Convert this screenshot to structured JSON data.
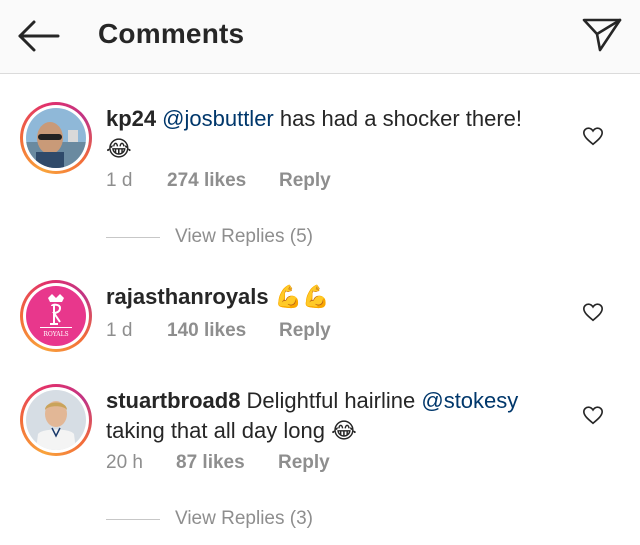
{
  "header": {
    "title": "Comments",
    "back_icon": "arrow-left-icon",
    "send_icon": "paper-plane-icon"
  },
  "comments": [
    {
      "username": "kp24",
      "mention": "@josbuttler",
      "text": " has had a shocker there!",
      "emoji": "😂",
      "time": "1 d",
      "likes": "274 likes",
      "reply": "Reply",
      "view_replies": "View Replies (5)"
    },
    {
      "username": "rajasthanroyals",
      "text": "",
      "emoji": "💪💪",
      "time": "1 d",
      "likes": "140 likes",
      "reply": "Reply",
      "logo_text": "ROYALS"
    },
    {
      "username": "stuartbroad8",
      "text_before": "Delightful hairline ",
      "mention": "@stokesy",
      "text_after": "taking that all day long",
      "emoji": "😂",
      "time": "20 h",
      "likes": "87 likes",
      "reply": "Reply",
      "view_replies": "View Replies (3)"
    }
  ],
  "colors": {
    "text": "#262626",
    "muted": "#8e8e8e",
    "mention": "#00376b",
    "ring_start": "#f9a33b",
    "ring_end": "#c13584",
    "royals_pink": "#e8378c"
  }
}
